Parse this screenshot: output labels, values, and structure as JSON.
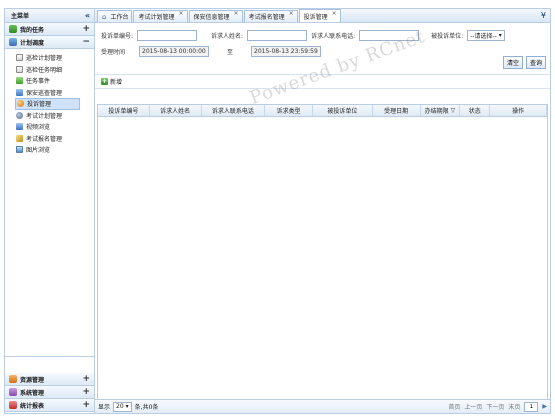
{
  "sidebar": {
    "header": "主菜单",
    "collapse_glyph": "«",
    "top_sections": [
      {
        "label": "我的任务",
        "toggle": "+",
        "icon": "green"
      },
      {
        "label": "计划调度",
        "toggle": "−",
        "icon": "blue"
      }
    ],
    "menu_items": [
      {
        "label": "巡检计划管理",
        "icon": "mi-doc"
      },
      {
        "label": "巡检任务明细",
        "icon": "mi-doc"
      },
      {
        "label": "任务事件",
        "icon": "mi-green"
      },
      {
        "label": "保安巡查管理",
        "icon": "mi-blue"
      },
      {
        "label": "投诉管理",
        "icon": "mi-circle"
      },
      {
        "label": "考试计划管理",
        "icon": "mi-gear"
      },
      {
        "label": "视频浏览",
        "icon": "mi-blue"
      },
      {
        "label": "考试报名管理",
        "icon": "mi-pen"
      },
      {
        "label": "图片浏览",
        "icon": "mi-img"
      }
    ],
    "active_index": 4,
    "bottom_sections": [
      {
        "label": "资源管理",
        "toggle": "+",
        "icon": "orange"
      },
      {
        "label": "系统管理",
        "toggle": "+",
        "icon": "purple"
      },
      {
        "label": "统计报表",
        "toggle": "+",
        "icon": "red"
      }
    ]
  },
  "tabs": {
    "home": "工作台",
    "items": [
      {
        "label": "考试计划管理"
      },
      {
        "label": "保安信息管理"
      },
      {
        "label": "考试报名管理"
      },
      {
        "label": "投诉管理"
      }
    ],
    "active_index": 3,
    "more_glyph": "¥"
  },
  "search": {
    "complaint_no_label": "投诉单编号:",
    "complaint_no_value": "",
    "name_label": "诉求人姓名:",
    "name_value": "",
    "phone_label": "诉求人联系电话:",
    "phone_value": "",
    "unit_label": "被投诉单位:",
    "unit_select": "--请选择--",
    "time_label": "受理时间",
    "time_from": "2015-08-13 00:00:00",
    "to_label": "至",
    "time_to": "2015-08-13 23:59:59",
    "clear_button": "清空",
    "query_button": "查询"
  },
  "toolbar": {
    "add_label": "新增"
  },
  "grid": {
    "columns": [
      "投诉单编号",
      "诉求人姓名",
      "诉求人联系电话",
      "诉求类型",
      "被投诉单位",
      "受理日期",
      "办结期限",
      "状态",
      "操作"
    ],
    "sort_glyph": "▽",
    "rows": []
  },
  "pager": {
    "show_label": "显示",
    "page_size": "20",
    "summary": "条,共0条",
    "first": "首页",
    "prev": "上一页",
    "next": "下一页",
    "last": "末页",
    "page_value": "1",
    "go_glyph": "▶"
  },
  "watermark": "Powered by RCnet"
}
